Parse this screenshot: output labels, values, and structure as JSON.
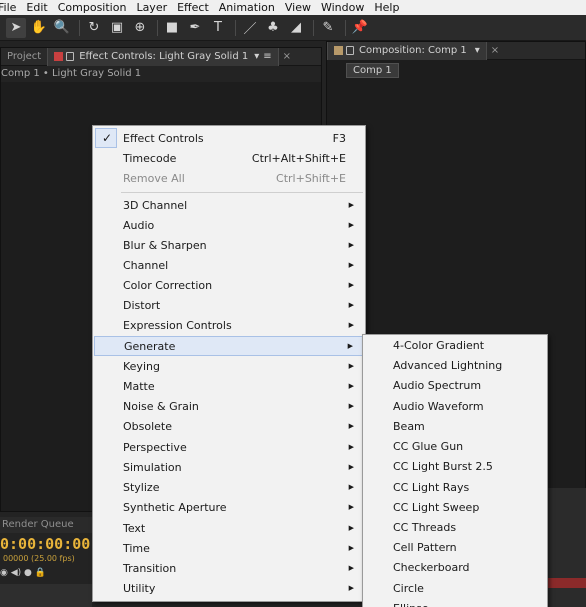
{
  "menubar": [
    "File",
    "Edit",
    "Composition",
    "Layer",
    "Effect",
    "Animation",
    "View",
    "Window",
    "Help"
  ],
  "left_panel": {
    "tab_project": "Project",
    "tab_effect_controls": "Effect Controls: Light Gray Solid 1",
    "subtitle": "Comp 1 • Light Gray Solid 1"
  },
  "right_panel": {
    "tab_composition": "Composition: Comp 1",
    "chip": "Comp 1"
  },
  "render_queue": {
    "tab": "Render Queue",
    "timecode": "0:00:00:00",
    "fps": "00000 (25.00 fps)"
  },
  "context_menu": {
    "effect_controls": {
      "label": "Effect Controls",
      "shortcut": "F3"
    },
    "timecode": {
      "label": "Timecode",
      "shortcut": "Ctrl+Alt+Shift+E"
    },
    "remove_all": {
      "label": "Remove All",
      "shortcut": "Ctrl+Shift+E"
    },
    "categories": [
      "3D Channel",
      "Audio",
      "Blur & Sharpen",
      "Channel",
      "Color Correction",
      "Distort",
      "Expression Controls",
      "Generate",
      "Keying",
      "Matte",
      "Noise & Grain",
      "Obsolete",
      "Perspective",
      "Simulation",
      "Stylize",
      "Synthetic Aperture",
      "Text",
      "Time",
      "Transition",
      "Utility"
    ]
  },
  "submenu": [
    "4-Color Gradient",
    "Advanced Lightning",
    "Audio Spectrum",
    "Audio Waveform",
    "Beam",
    "CC Glue Gun",
    "CC Light Burst 2.5",
    "CC Light Rays",
    "CC Light Sweep",
    "CC Threads",
    "Cell Pattern",
    "Checkerboard",
    "Circle",
    "Ellipse"
  ],
  "colors": {
    "accent_timecode": "#e8b43a",
    "highlight": "#dfe8f6"
  }
}
